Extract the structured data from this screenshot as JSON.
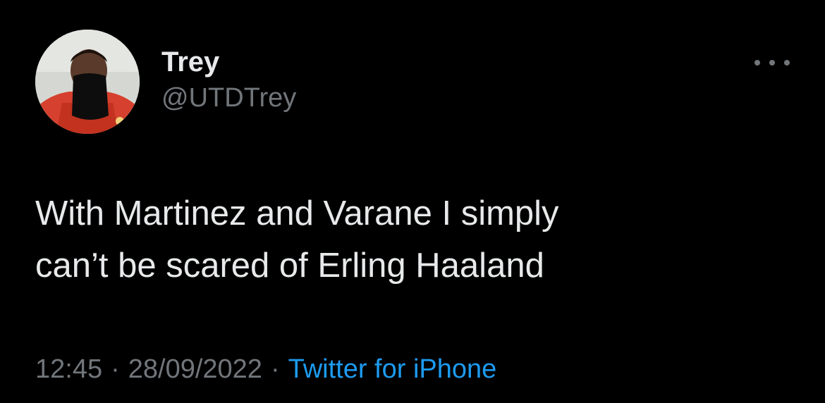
{
  "tweet": {
    "author": {
      "display_name": "Trey",
      "handle": "@UTDTrey"
    },
    "text": "With Martinez and Varane I simply\ncan’t be scared of Erling Haaland",
    "time": "12:45",
    "separator": "·",
    "date": "28/09/2022",
    "source": "Twitter for iPhone"
  },
  "icons": {
    "more": "more-horizontal-icon"
  },
  "colors": {
    "background": "#000000",
    "primary_text": "#e7e9ea",
    "secondary_text": "#71767b",
    "link": "#1d9bf0"
  }
}
